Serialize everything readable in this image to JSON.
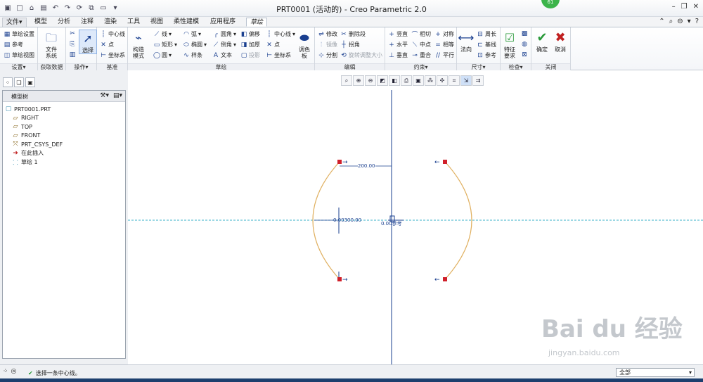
{
  "window": {
    "title": "PRT0001 (活动的) - Creo Parametric 2.0",
    "badge": "61"
  },
  "tabs": [
    {
      "label": "文件▾"
    },
    {
      "label": "模型"
    },
    {
      "label": "分析"
    },
    {
      "label": "注释"
    },
    {
      "label": "渲染"
    },
    {
      "label": "工具"
    },
    {
      "label": "视图"
    },
    {
      "label": "柔性建模"
    },
    {
      "label": "应用程序"
    },
    {
      "label": "草绘"
    }
  ],
  "ribbon": {
    "setup": {
      "label": "设置▾",
      "sketch_setup": "草绘设置",
      "reference": "参考",
      "sketch_view": "草绘视图"
    },
    "get_data": {
      "label": "获取数据",
      "file_system": "文件\n系统"
    },
    "operations": {
      "label": "操作▾",
      "select": "选择"
    },
    "datum": {
      "label": "基准",
      "centerline": "中心线",
      "point": "点",
      "coord_sys": "坐标系"
    },
    "sketch": {
      "label": "草绘",
      "construction_mode": "构造\n模式",
      "line": "线",
      "rectangle": "矩形",
      "circle": "圆",
      "arc": "弧",
      "ellipse": "椭圆",
      "spline": "样条",
      "fillet": "圆角",
      "chamfer": "倒角",
      "text": "文本",
      "offset": "偏移",
      "thicken": "加厚",
      "project": "投影",
      "centerline": "中心线",
      "point": "点",
      "coord_sys": "坐标系",
      "palette": "调色\n板"
    },
    "edit": {
      "label": "编辑",
      "modify": "修改",
      "delete_segment": "删除段",
      "mirror": "镜像",
      "corner": "拐角",
      "divide": "分割",
      "rotate_resize": "旋转调整大小"
    },
    "constrain": {
      "label": "约束▾",
      "vertical": "竖直",
      "tangent": "相切",
      "symmetric": "对称",
      "horizontal": "水平",
      "midpoint": "中点",
      "equal": "相等",
      "perpendicular": "垂直",
      "coincident": "重合",
      "parallel": "平行"
    },
    "dimension": {
      "label": "尺寸▾",
      "normal": "法向",
      "perimeter": "周长",
      "baseline": "基线",
      "reference": "参考"
    },
    "inspect": {
      "label": "检查▾",
      "feature_req": "特征\n要求"
    },
    "close": {
      "label": "关闭",
      "ok": "确定",
      "cancel": "取消"
    }
  },
  "model_tree": {
    "title": "模型树",
    "items": [
      {
        "label": "PRT0001.PRT",
        "icon": "part-icon"
      },
      {
        "label": "RIGHT",
        "icon": "plane-icon"
      },
      {
        "label": "TOP",
        "icon": "plane-icon"
      },
      {
        "label": "FRONT",
        "icon": "plane-icon"
      },
      {
        "label": "PRT_CSYS_DEF",
        "icon": "csys-icon"
      },
      {
        "label": "在此插入",
        "icon": "insert-arrow-icon"
      },
      {
        "label": "草绘 1",
        "icon": "sketch-icon"
      }
    ]
  },
  "sketch": {
    "dim_top": "200.00",
    "dim_left": "0.00300.00",
    "dim_center": "0.00参考"
  },
  "status": {
    "message": "选择一条中心线。",
    "filter": "全部"
  },
  "watermark": {
    "brand": "Bai du 经验",
    "url": "jingyan.baidu.com"
  },
  "colors": {
    "accent": "#1a3f8f",
    "arc": "#e0b060",
    "centerline": "#3ab0c8",
    "endpoint": "#d0202a",
    "ok": "#2a9a3a",
    "cancel": "#c02020"
  }
}
